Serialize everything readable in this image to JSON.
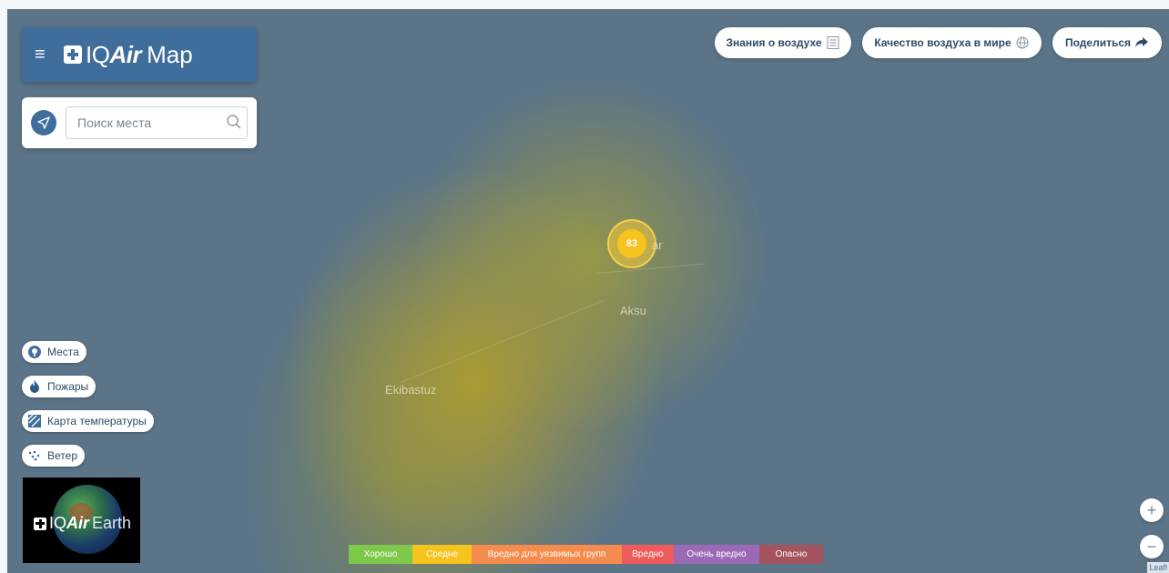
{
  "header": {
    "menu_icon": "hamburger-menu-icon",
    "logo_text_iq": "IQ",
    "logo_text_air": "Air",
    "logo_text_map": "Map"
  },
  "search": {
    "placeholder": "Поиск места",
    "locate_icon": "navigation-arrow-icon",
    "search_icon": "magnifier-icon"
  },
  "top_buttons": {
    "knowledge": "Знания о воздухе",
    "world_air": "Качество воздуха в мире",
    "share": "Поделиться"
  },
  "map": {
    "station_aqi": "83",
    "station_color": "#f6c31f",
    "places": {
      "aksu": "Aksu",
      "ekibastuz": "Ekibastuz",
      "partial_label": "ar"
    }
  },
  "layers": {
    "places": "Места",
    "fires": "Пожары",
    "temperature": "Карта температуры",
    "wind": "Ветер"
  },
  "earth": {
    "iq": "IQ",
    "air": "Air",
    "earth": "Earth"
  },
  "legend": [
    {
      "label": "Хорошо",
      "color": "#7ec84a"
    },
    {
      "label": "Средне",
      "color": "#f6c31f"
    },
    {
      "label": "Вредно для уязвимых групп",
      "color": "#f58b4c"
    },
    {
      "label": "Вредно",
      "color": "#ef5a5a"
    },
    {
      "label": "Очень вредно",
      "color": "#9b69b5"
    },
    {
      "label": "Опасно",
      "color": "#a4545e"
    }
  ],
  "zoom": {
    "in": "+",
    "out": "−"
  },
  "attribution": "Leafl"
}
